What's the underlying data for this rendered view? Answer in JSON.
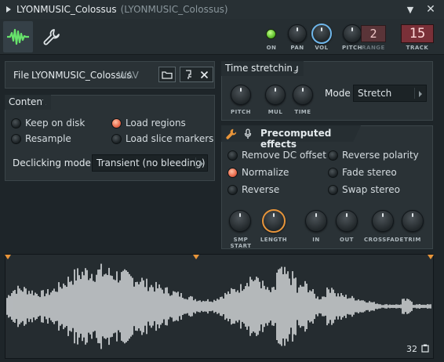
{
  "window": {
    "title": "LYONMUSIC_Colossus",
    "subtitle": "(LYONMUSIC_Colossus)",
    "menu_arrow": "▼",
    "close_glyph": "✕"
  },
  "toolbar": {
    "waveform_tab_icon": "waveform-icon",
    "settings_tab_icon": "wrench-icon"
  },
  "channel": {
    "on_label": "ON",
    "pan_label": "PAN",
    "vol_label": "VOL",
    "pitch_label": "PITCH",
    "range_label": "RANGE",
    "range_value": "2",
    "track_label": "TRACK",
    "track_value": "15"
  },
  "file": {
    "label": "File",
    "name": "LYONMUSIC_Colossus",
    "ext": "WAV"
  },
  "content": {
    "heading": "Content",
    "options": [
      {
        "label": "Keep on disk",
        "checked": false
      },
      {
        "label": "Load regions",
        "checked": true
      },
      {
        "label": "Resample",
        "checked": false
      },
      {
        "label": "Load slice markers",
        "checked": false
      }
    ],
    "declicking_label": "Declicking mode",
    "declicking_value": "Transient (no bleeding)"
  },
  "time_stretching": {
    "heading": "Time stretching",
    "knobs": [
      "PITCH",
      "MUL",
      "TIME"
    ],
    "mode_label": "Mode",
    "mode_value": "Stretch"
  },
  "precomputed": {
    "heading": "Precomputed effects",
    "options": [
      {
        "label": "Remove DC offset",
        "checked": false
      },
      {
        "label": "Reverse polarity",
        "checked": false
      },
      {
        "label": "Normalize",
        "checked": true
      },
      {
        "label": "Fade stereo",
        "checked": false
      },
      {
        "label": "Reverse",
        "checked": false
      },
      {
        "label": "Swap stereo",
        "checked": false
      }
    ],
    "knobs": [
      "SMP START",
      "LENGTH",
      "IN",
      "OUT",
      "CROSSFADE",
      "TRIM"
    ]
  },
  "waveform": {
    "zoom_value": "32",
    "accent": "#e8953a",
    "wave_color": "#d8dcde"
  },
  "colors": {
    "accent_green": "#67e36b",
    "accent_blue": "#6fb6ea",
    "accent_orange": "#e8953a",
    "led_red": "#e96a4c"
  }
}
